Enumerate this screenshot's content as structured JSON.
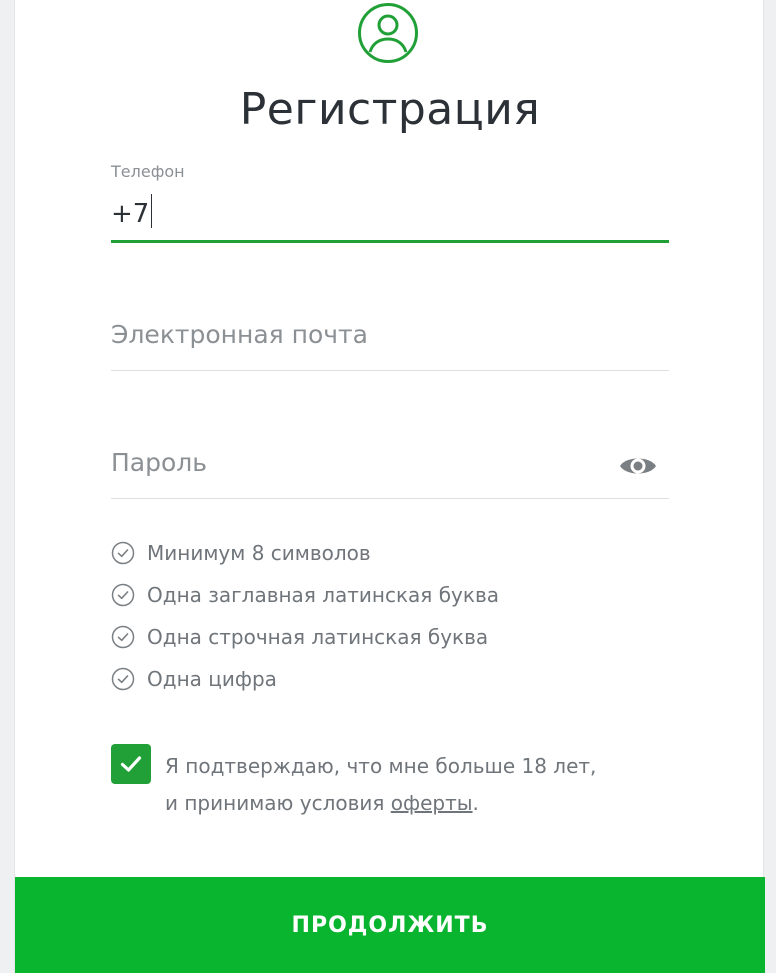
{
  "header": {
    "title": "Регистрация",
    "icon": "user-circle-icon"
  },
  "form": {
    "phone": {
      "label": "Телефон",
      "value": "+7"
    },
    "email": {
      "placeholder": "Электронная почта"
    },
    "password": {
      "placeholder": "Пароль",
      "toggle_icon": "eye-icon"
    }
  },
  "password_rules": [
    {
      "text": "Минимум 8 символов",
      "icon": "check-circle-icon"
    },
    {
      "text": "Одна заглавная латинская буква",
      "icon": "check-circle-icon"
    },
    {
      "text": "Одна строчная латинская буква",
      "icon": "check-circle-icon"
    },
    {
      "text": "Одна цифра",
      "icon": "check-circle-icon"
    }
  ],
  "consent": {
    "checked": true,
    "line1": "Я подтверждаю, что мне больше 18 лет,",
    "line2_prefix": "и принимаю условия ",
    "link_text": "оферты",
    "line2_suffix": "."
  },
  "actions": {
    "continue_label": "ПРОДОЛЖИТЬ"
  },
  "colors": {
    "accent": "#21a038",
    "button": "#09b42f",
    "text_muted": "#6f757a"
  }
}
